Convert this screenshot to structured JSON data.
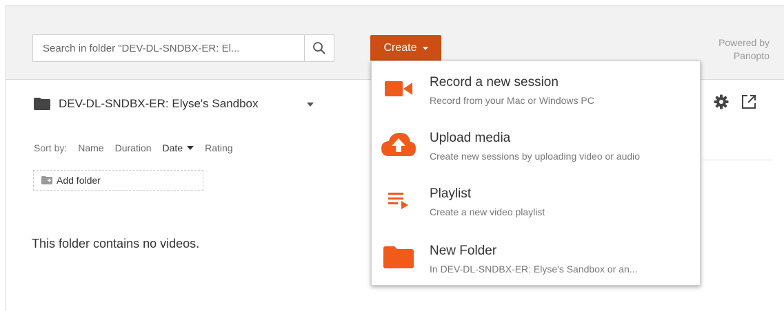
{
  "search": {
    "placeholder": "Search in folder \"DEV-DL-SNDBX-ER: El...",
    "icon": "search-icon"
  },
  "toolbar": {
    "create_label": "Create",
    "accent": "#cc4e14"
  },
  "powered": {
    "line1": "Powered by",
    "line2": "Panopto"
  },
  "folder": {
    "name": "DEV-DL-SNDBX-ER: Elyse's Sandbox"
  },
  "sort": {
    "label": "Sort by:",
    "options": [
      "Name",
      "Duration",
      "Date",
      "Rating"
    ],
    "active": "Date"
  },
  "add_folder": {
    "label": "Add folder"
  },
  "empty_message": "This folder contains no videos.",
  "create_menu": {
    "items": [
      {
        "title": "Record a new session",
        "desc": "Record from your Mac or Windows PC",
        "icon": "video-camera-icon"
      },
      {
        "title": "Upload media",
        "desc": "Create new sessions by uploading video or audio",
        "icon": "cloud-upload-icon"
      },
      {
        "title": "Playlist",
        "desc": "Create a new video playlist",
        "icon": "playlist-icon"
      },
      {
        "title": "New Folder",
        "desc": "In DEV-DL-SNDBX-ER: Elyse's Sandbox or an...",
        "icon": "folder-icon"
      }
    ]
  }
}
